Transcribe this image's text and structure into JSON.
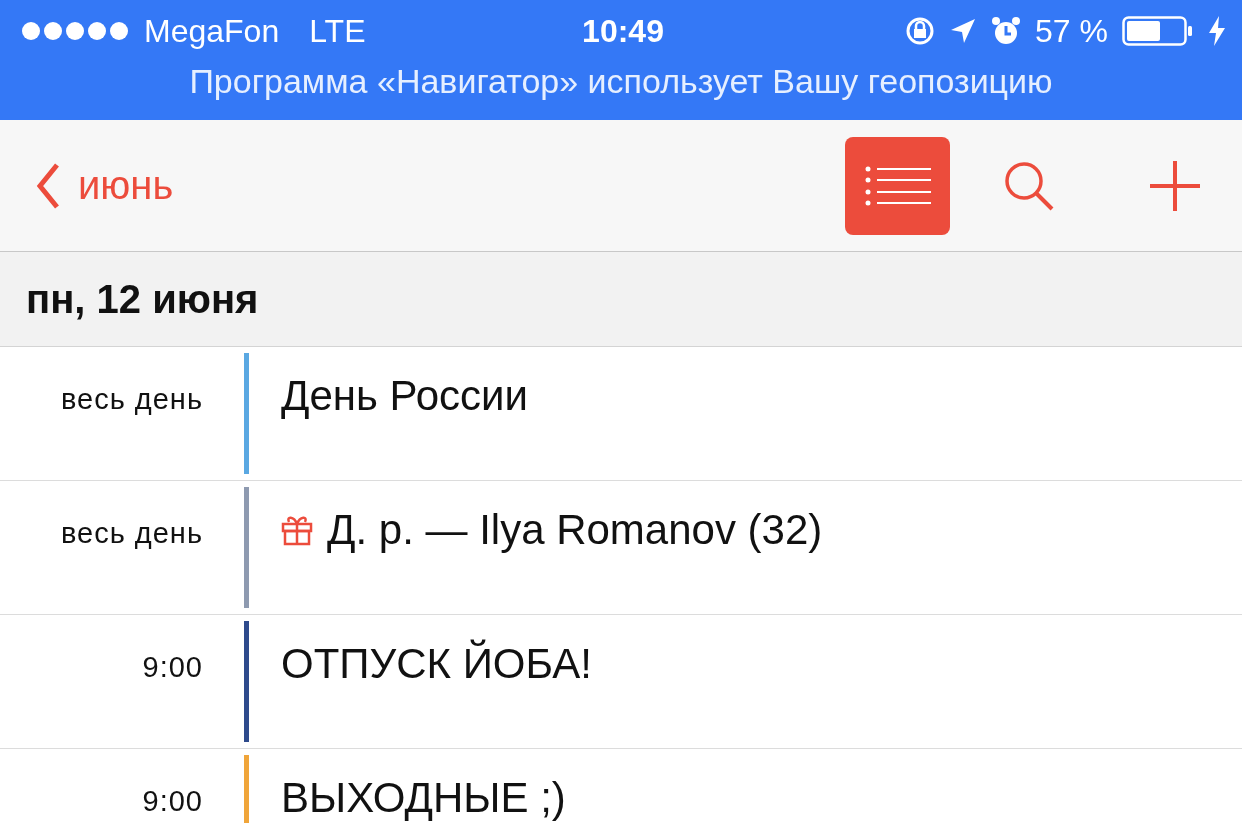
{
  "status_bar": {
    "carrier": "MegaFon",
    "network": "LTE",
    "time": "10:49",
    "battery": "57 %"
  },
  "banner": {
    "text": "Программа «Навигатор» использует Вашу геопозицию"
  },
  "nav_bar": {
    "back_label": "июнь",
    "list_view": {
      "selected": true
    }
  },
  "day_header": {
    "title": "пн, 12 июня"
  },
  "events": [
    {
      "time": "весь день",
      "title": "День России",
      "color": "#5aa8e2",
      "kind": "plain"
    },
    {
      "time": "весь день",
      "title": "Д. р. — Ilya Romanov (32)",
      "color": "#8e9ab0",
      "kind": "birthday"
    },
    {
      "time": "9:00",
      "title": "ОТПУСК ЙОБА!",
      "color": "#2e4a8c",
      "kind": "plain"
    },
    {
      "time": "9:00",
      "title": "ВЫХОДНЫЕ ;)",
      "color": "#f0a53a",
      "kind": "plain"
    }
  ]
}
